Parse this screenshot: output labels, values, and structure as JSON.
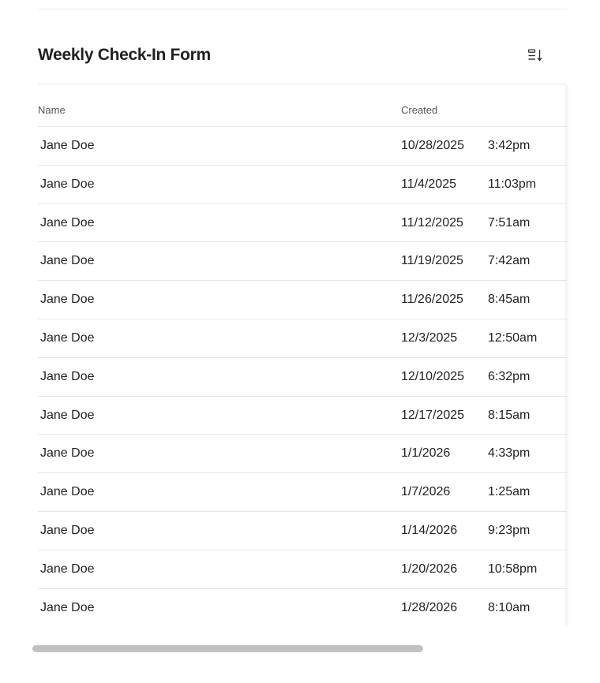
{
  "form": {
    "title": "Weekly Check-In Form",
    "sort_icon": "sort-list-icon"
  },
  "table": {
    "columns": {
      "name": "Name",
      "created": "Created"
    },
    "rows": [
      {
        "name": "Jane Doe",
        "date": "10/28/2025",
        "time": "3:42pm"
      },
      {
        "name": "Jane Doe",
        "date": "11/4/2025",
        "time": "11:03pm"
      },
      {
        "name": "Jane Doe",
        "date": "11/12/2025",
        "time": "7:51am"
      },
      {
        "name": "Jane Doe",
        "date": "11/19/2025",
        "time": "7:42am"
      },
      {
        "name": "Jane Doe",
        "date": "11/26/2025",
        "time": "8:45am"
      },
      {
        "name": "Jane Doe",
        "date": "12/3/2025",
        "time": "12:50am"
      },
      {
        "name": "Jane Doe",
        "date": "12/10/2025",
        "time": "6:32pm"
      },
      {
        "name": "Jane Doe",
        "date": "12/17/2025",
        "time": "8:15am"
      },
      {
        "name": "Jane Doe",
        "date": "1/1/2026",
        "time": "4:33pm"
      },
      {
        "name": "Jane Doe",
        "date": "1/7/2026",
        "time": "1:25am"
      },
      {
        "name": "Jane Doe",
        "date": "1/14/2026",
        "time": "9:23pm"
      },
      {
        "name": "Jane Doe",
        "date": "1/20/2026",
        "time": "10:58pm"
      },
      {
        "name": "Jane Doe",
        "date": "1/28/2026",
        "time": "8:10am"
      }
    ]
  },
  "scroll": {
    "horizontal_visible_fraction": 0.73,
    "horizontal_position": 0
  }
}
